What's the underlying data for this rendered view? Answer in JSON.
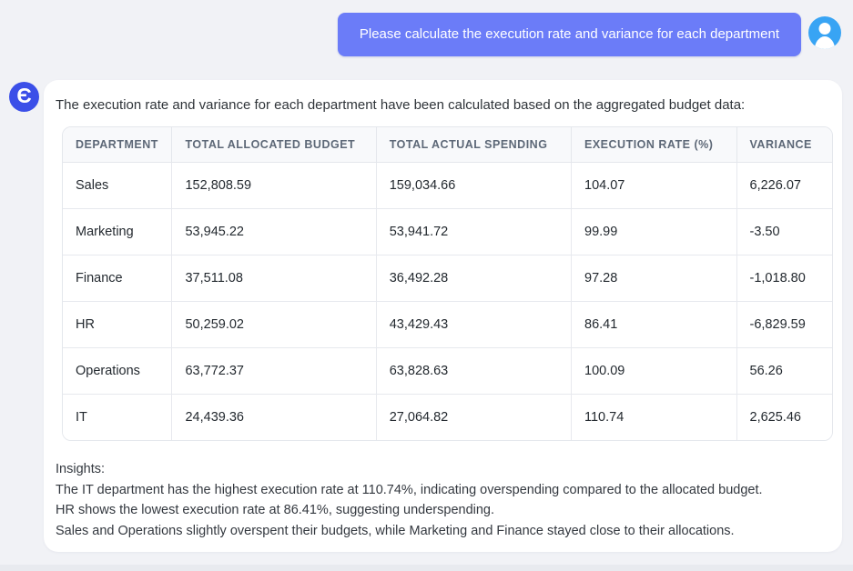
{
  "user_message": {
    "text": "Please calculate the execution rate and variance for each department"
  },
  "assistant": {
    "intro": "The execution rate and variance for each department have been calculated based on the aggregated budget data:",
    "insights_label": "Insights:",
    "insight_1": "The IT department has the highest execution rate at 110.74%, indicating overspending compared to the allocated budget.",
    "insight_2": "HR shows the lowest execution rate at 86.41%, suggesting underspending.",
    "insight_3": "Sales and Operations slightly overspent their budgets, while Marketing and Finance stayed close to their allocations."
  },
  "icons": {
    "assistant_logo_glyph": "Є",
    "user_avatar": "person-icon"
  },
  "colors": {
    "user_bubble": "#6b7cf8",
    "user_avatar_bg": "#38a4f4",
    "assistant_logo_bg": "#3b4fe8",
    "page_bg": "#f1f2f6",
    "card_bg": "#ffffff",
    "table_header_bg": "#f8f9fb",
    "table_border": "#e4e7ec"
  },
  "table": {
    "columns": [
      "DEPARTMENT",
      "TOTAL ALLOCATED BUDGET",
      "TOTAL ACTUAL SPENDING",
      "EXECUTION RATE (%)",
      "VARIANCE"
    ],
    "rows": [
      [
        "Sales",
        "152,808.59",
        "159,034.66",
        "104.07",
        "6,226.07"
      ],
      [
        "Marketing",
        "53,945.22",
        "53,941.72",
        "99.99",
        "-3.50"
      ],
      [
        "Finance",
        "37,511.08",
        "36,492.28",
        "97.28",
        "-1,018.80"
      ],
      [
        "HR",
        "50,259.02",
        "43,429.43",
        "86.41",
        "-6,829.59"
      ],
      [
        "Operations",
        "63,772.37",
        "63,828.63",
        "100.09",
        "56.26"
      ],
      [
        "IT",
        "24,439.36",
        "27,064.82",
        "110.74",
        "2,625.46"
      ]
    ]
  }
}
